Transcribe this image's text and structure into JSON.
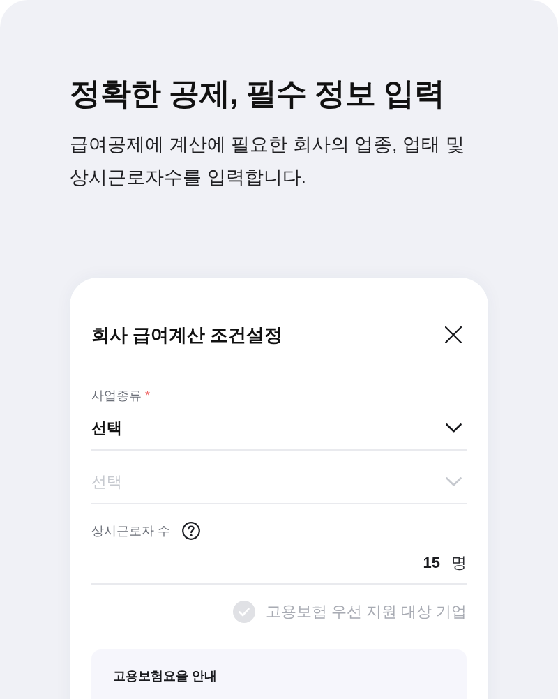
{
  "intro": {
    "title": "정확한 공제, 필수 정보 입력",
    "description": "급여공제에 계산에 필요한 회사의 업종, 업태 및 상시근로자수를 입력합니다."
  },
  "dialog": {
    "title": "회사 급여계산 조건설정",
    "fields": [
      {
        "kind": "select",
        "label": "사업종류",
        "required_mark": "*",
        "placeholder": "선택",
        "disabled": false
      },
      {
        "kind": "select",
        "placeholder": "선택",
        "disabled": true
      },
      {
        "kind": "number",
        "label": "상시근로자 수",
        "help": true,
        "value": "15",
        "unit": "명"
      },
      {
        "kind": "checkbox",
        "label": "고용보험 우선 지원 대상 기업",
        "checked": false
      }
    ],
    "info": {
      "title": "고용보험요율 안내"
    }
  }
}
